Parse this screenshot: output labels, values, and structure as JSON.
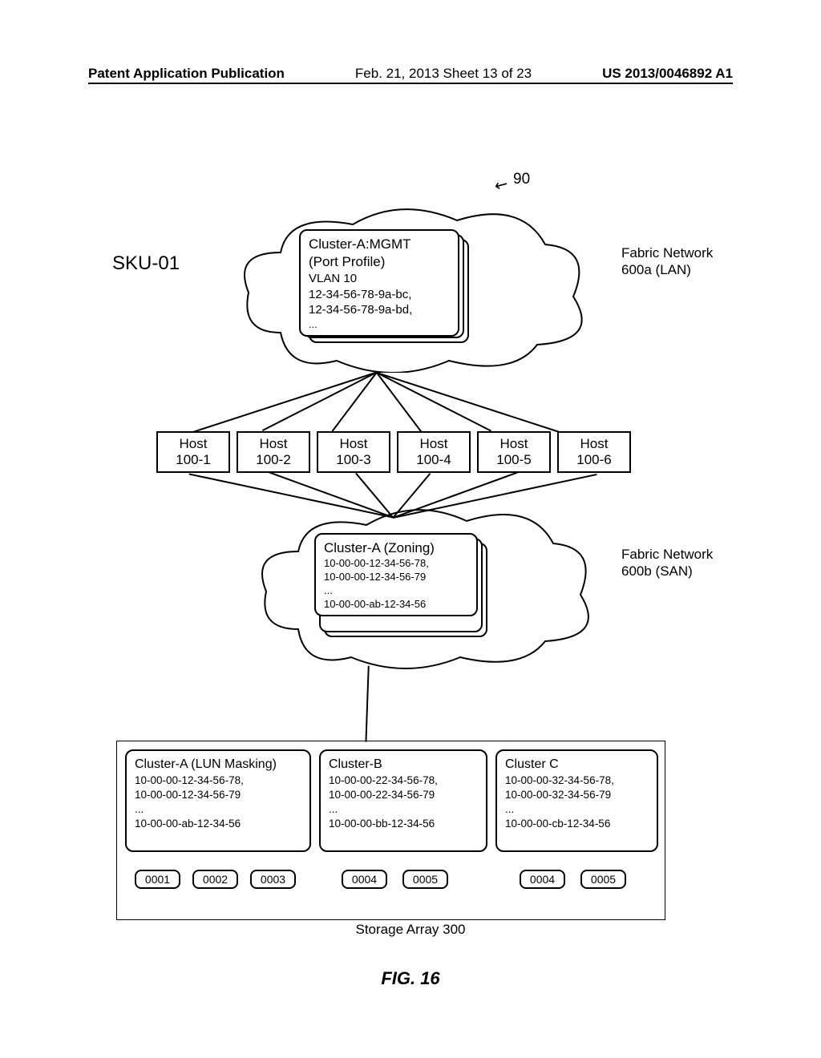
{
  "header": {
    "left": "Patent Application Publication",
    "center": "Feb. 21, 2013  Sheet 13 of 23",
    "right": "US 2013/0046892 A1"
  },
  "sku": "SKU-01",
  "ref90": "90",
  "cloud_lan": {
    "label": "Fabric Network\n600a (LAN)",
    "profile": {
      "title": "Cluster-A:MGMT",
      "subtitle": "(Port Profile)",
      "vlan": "VLAN 10",
      "mac1": "12-34-56-78-9a-bc,",
      "mac2": "12-34-56-78-9a-bd,",
      "ell": "..."
    }
  },
  "hosts": [
    {
      "name": "Host",
      "id": "100-1"
    },
    {
      "name": "Host",
      "id": "100-2"
    },
    {
      "name": "Host",
      "id": "100-3"
    },
    {
      "name": "Host",
      "id": "100-4"
    },
    {
      "name": "Host",
      "id": "100-5"
    },
    {
      "name": "Host",
      "id": "100-6"
    }
  ],
  "cloud_san": {
    "label": "Fabric Network\n600b (SAN)",
    "zoning": {
      "title": "Cluster-A (Zoning)",
      "w1": "10-00-00-12-34-56-78,",
      "w2": "10-00-00-12-34-56-79",
      "ell": "...",
      "w3": "10-00-00-ab-12-34-56"
    }
  },
  "storage": {
    "caption": "Storage Array 300",
    "clusters": [
      {
        "title": "Cluster-A (LUN Masking)",
        "w1": "10-00-00-12-34-56-78,",
        "w2": "10-00-00-12-34-56-79",
        "ell": "...",
        "w3": "10-00-00-ab-12-34-56"
      },
      {
        "title": "Cluster-B",
        "w1": "10-00-00-22-34-56-78,",
        "w2": "10-00-00-22-34-56-79",
        "ell": "...",
        "w3": "10-00-00-bb-12-34-56"
      },
      {
        "title": "Cluster C",
        "w1": "10-00-00-32-34-56-78,",
        "w2": "10-00-00-32-34-56-79",
        "ell": "...",
        "w3": "10-00-00-cb-12-34-56"
      }
    ],
    "luns": [
      [
        "0001",
        "0002",
        "0003"
      ],
      [
        "0004",
        "0005"
      ],
      [
        "0004",
        "0005"
      ]
    ]
  },
  "figure": "FIG. 16"
}
